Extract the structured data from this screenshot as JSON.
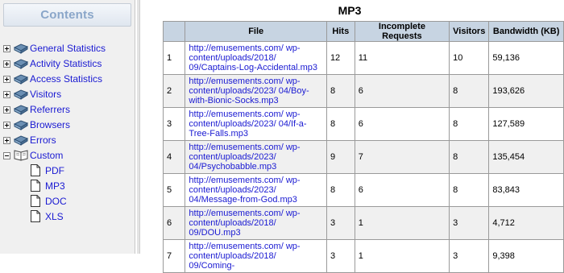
{
  "sidebar": {
    "title": "Contents",
    "items": [
      {
        "label": "General Statistics",
        "toggle": "+"
      },
      {
        "label": "Activity Statistics",
        "toggle": "+"
      },
      {
        "label": "Access Statistics",
        "toggle": "+"
      },
      {
        "label": "Visitors",
        "toggle": "+"
      },
      {
        "label": "Referrers",
        "toggle": "+"
      },
      {
        "label": "Browsers",
        "toggle": "+"
      },
      {
        "label": "Errors",
        "toggle": "+"
      },
      {
        "label": "Custom",
        "toggle": "-"
      }
    ],
    "custom_children": [
      "PDF",
      "MP3",
      "DOC",
      "XLS"
    ]
  },
  "main": {
    "title": "MP3",
    "columns": [
      "",
      "File",
      "Hits",
      "Incomplete Requests",
      "Visitors",
      "Bandwidth (KB)"
    ],
    "rows": [
      {
        "num": "1",
        "file": "http://emusements.com/ wp-content/uploads/2018/ 09/Captains-Log-Accidental.mp3",
        "hits": "12",
        "incomplete": "11",
        "visitors": "10",
        "bandwidth": "59,136"
      },
      {
        "num": "2",
        "file": "http://emusements.com/ wp-content/uploads/2023/ 04/Boy-with-Bionic-Socks.mp3",
        "hits": "8",
        "incomplete": "6",
        "visitors": "8",
        "bandwidth": "193,626"
      },
      {
        "num": "3",
        "file": "http://emusements.com/ wp-content/uploads/2023/ 04/If-a-Tree-Falls.mp3",
        "hits": "8",
        "incomplete": "6",
        "visitors": "8",
        "bandwidth": "127,589"
      },
      {
        "num": "4",
        "file": "http://emusements.com/ wp-content/uploads/2023/ 04/Psychobabble.mp3",
        "hits": "9",
        "incomplete": "7",
        "visitors": "8",
        "bandwidth": "135,454"
      },
      {
        "num": "5",
        "file": "http://emusements.com/ wp-content/uploads/2023/ 04/Message-from-God.mp3",
        "hits": "8",
        "incomplete": "6",
        "visitors": "8",
        "bandwidth": "83,843"
      },
      {
        "num": "6",
        "file": "http://emusements.com/ wp-content/uploads/2018/ 09/DOU.mp3",
        "hits": "3",
        "incomplete": "1",
        "visitors": "3",
        "bandwidth": "4,712"
      },
      {
        "num": "7",
        "file": "http://emusements.com/ wp-content/uploads/2018/ 09/Coming-",
        "hits": "3",
        "incomplete": "1",
        "visitors": "3",
        "bandwidth": "9,398"
      }
    ]
  }
}
